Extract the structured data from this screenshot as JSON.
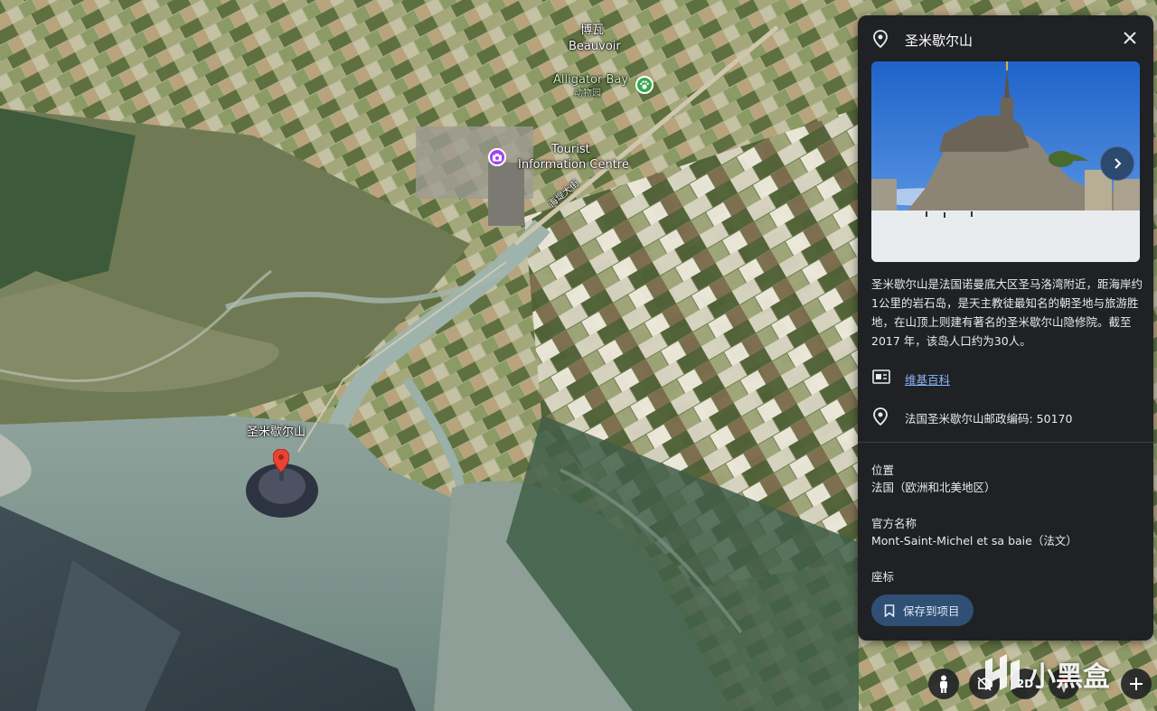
{
  "map": {
    "labels": {
      "town_cn": "博瓦",
      "town_en": "Beauvoir",
      "zoo_en": "Alligator Bay",
      "zoo_cn": "动物园",
      "tourist_line1": "Tourist",
      "tourist_line2": "Information Centre",
      "road": "海堤大街",
      "island": "圣米歇尔山"
    },
    "controls": {
      "mode_2d": "2D"
    }
  },
  "panel": {
    "title": "圣米歇尔山",
    "description": "圣米歇尔山是法国诺曼底大区圣马洛湾附近，距海岸约1公里的岩石岛，是天主教徒最知名的朝圣地与旅游胜地，在山顶上则建有著名的圣米歇尔山隐修院。截至 2017 年，该岛人口约为30人。",
    "wiki_link": "维基百科",
    "postal": "法国圣米歇尔山邮政编码: 50170",
    "location_label": "位置",
    "location_value": "法国（欧洲和北美地区）",
    "official_name_label": "官方名称",
    "official_name_value": "Mont-Saint-Michel et sa baie（法文）",
    "coords_label": "座标",
    "save_button": "保存到项目"
  },
  "watermark": "小黑盒",
  "colors": {
    "panel_bg": "#202124",
    "link": "#8ab4f8",
    "pin_red": "#ea4335",
    "poi_purple": "#a142f4",
    "poi_green": "#34a853",
    "save_bg": "#2f4f74"
  }
}
